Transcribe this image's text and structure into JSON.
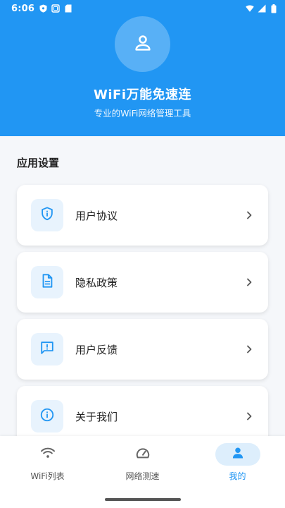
{
  "status_bar": {
    "time": "6:06",
    "left_icons": [
      "shield-icon",
      "screen-icon",
      "sd-card-icon"
    ],
    "right_icons": [
      "wifi-icon",
      "signal-icon",
      "battery-icon"
    ]
  },
  "header": {
    "title": "WiFi万能免速连",
    "subtitle": "专业的WiFi网络管理工具",
    "avatar_icon": "person-icon",
    "background_color": "#2196f3"
  },
  "section": {
    "title": "应用设置",
    "items": [
      {
        "label": "用户协议",
        "icon": "shield-info-icon"
      },
      {
        "label": "隐私政策",
        "icon": "document-icon"
      },
      {
        "label": "用户反馈",
        "icon": "feedback-icon"
      },
      {
        "label": "关于我们",
        "icon": "info-icon"
      }
    ]
  },
  "bottom_nav": {
    "items": [
      {
        "label": "WiFi列表",
        "icon": "wifi-icon",
        "active": false
      },
      {
        "label": "网络测速",
        "icon": "speedometer-icon",
        "active": false
      },
      {
        "label": "我的",
        "icon": "person-icon",
        "active": true
      }
    ]
  },
  "colors": {
    "accent": "#2196f3",
    "icon_bg": "#e8f3fd",
    "active_nav_bg": "#ddeefc"
  }
}
